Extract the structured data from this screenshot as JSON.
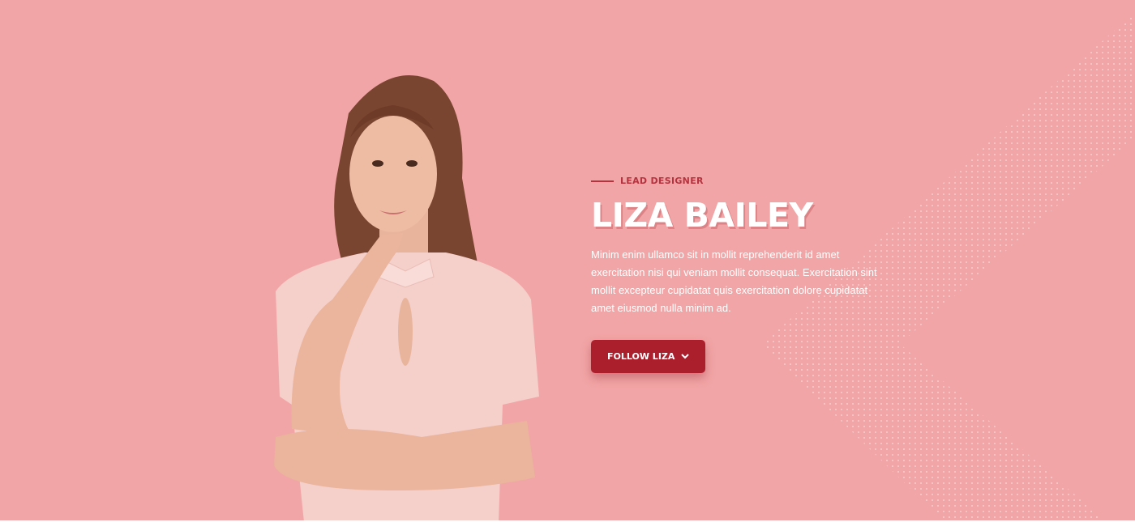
{
  "hero": {
    "eyebrow": "LEAD DESIGNER",
    "name": "LIZA BAILEY",
    "description": "Minim enim ullamco sit in mollit reprehenderit id amet exercitation nisi qui veniam mollit consequat. Exercitation sint mollit excepteur cupidatat quis exercitation dolore cupidatat amet eiusmod nulla minim ad.",
    "button_label": "FOLLOW LIZA",
    "button_icon": "chevron-down-icon"
  },
  "colors": {
    "background": "#f2a5a6",
    "accent": "#ab1f2d",
    "eyebrow": "#b5323f"
  }
}
